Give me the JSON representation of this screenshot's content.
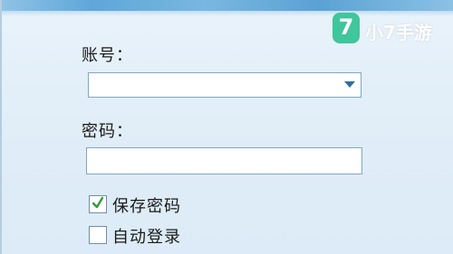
{
  "login": {
    "account_label": "账号：",
    "account_value": "",
    "password_label": "密码：",
    "password_value": "",
    "save_password_label": "保存密码",
    "save_password_checked": true,
    "auto_login_label": "自动登录",
    "auto_login_checked": false
  },
  "watermark": {
    "logo_glyph": "7",
    "text": "小7手游"
  },
  "colors": {
    "panel_bg": "#e2eef8",
    "header": "#5ea7d8",
    "input_border": "#7fa7c4",
    "check_mark": "#2f9a3a",
    "watermark_logo": "#3fc69a"
  }
}
